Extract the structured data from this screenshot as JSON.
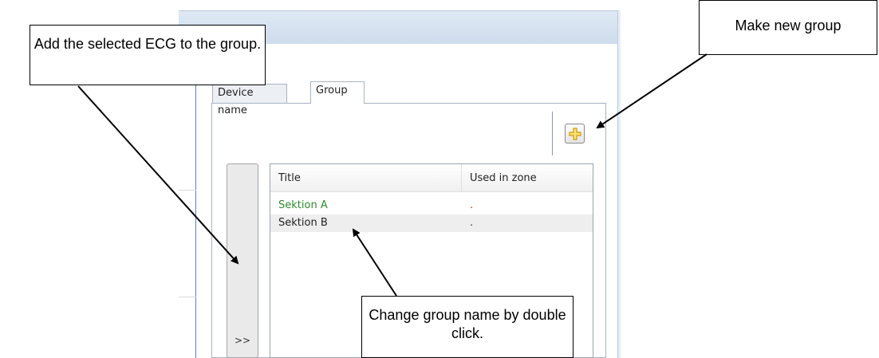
{
  "tabs": [
    {
      "label": "Device name"
    },
    {
      "label": "Group"
    }
  ],
  "toolbar": {
    "add_group_icon": "plus-icon"
  },
  "add_button": {
    "label": ">>"
  },
  "list": {
    "columns": [
      "Title",
      "Used in zone"
    ],
    "rows": [
      {
        "title": "Sektion A",
        "used_in_zone": "."
      },
      {
        "title": "Sektion B",
        "used_in_zone": "."
      }
    ]
  },
  "callouts": {
    "add_to_group": "Add the selected ECG to the group.",
    "make_new_group": "Make new group",
    "change_group_name": "Change group name by double click."
  },
  "colors": {
    "active_row_text": "#2e8b2e",
    "used_marker": "#c0392b",
    "plus_icon": "#f0b400"
  }
}
